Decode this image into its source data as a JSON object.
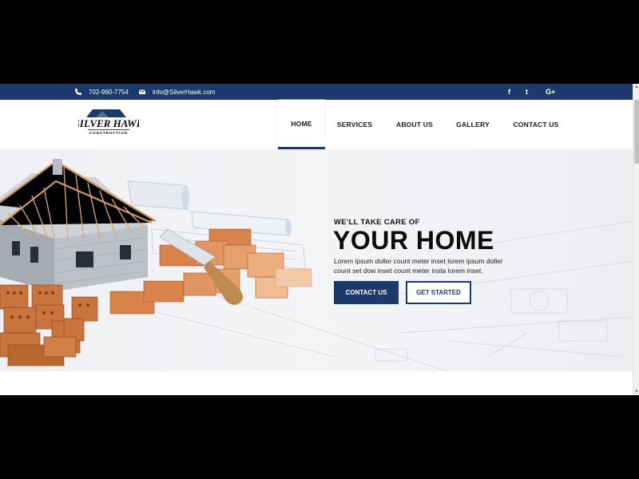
{
  "topbar": {
    "phone": "702-960-7754",
    "email": "info@SilverHawk.com",
    "social": [
      {
        "icon": "facebook-icon",
        "label": "f"
      },
      {
        "icon": "twitter-icon",
        "label": "t"
      },
      {
        "icon": "google-plus-icon",
        "label": "G+"
      }
    ],
    "bg_color": "#1b3a6b"
  },
  "logo": {
    "top": "SILVER HAWK",
    "bottom": "CONSTRUCTION"
  },
  "nav": {
    "items": [
      {
        "label": "HOME",
        "active": true
      },
      {
        "label": "SERVICES",
        "active": false
      },
      {
        "label": "ABOUT US",
        "active": false
      },
      {
        "label": "GALLERY",
        "active": false
      },
      {
        "label": "CONTACT US",
        "active": false
      }
    ]
  },
  "hero": {
    "tagline": "WE'LL TAKE CARE OF",
    "headline": "YOUR HOME",
    "body": "Lorem ipsum doller count meter inset lorem ipsum doller count set dow inset count meter insta lorem inset.",
    "primary_button": "CONTACT US",
    "secondary_button": "GET STARTED"
  },
  "colors": {
    "accent": "#1b3a6b",
    "brick": "#d9824a"
  }
}
